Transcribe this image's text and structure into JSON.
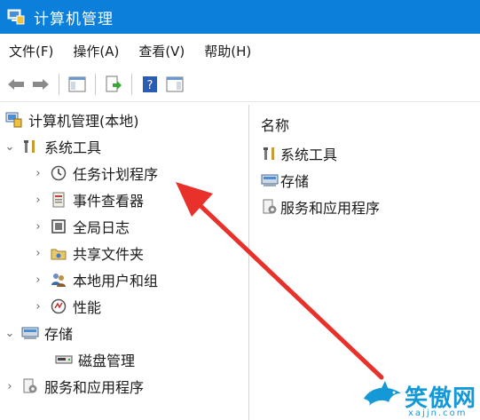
{
  "window": {
    "title": "计算机管理"
  },
  "menu": [
    "文件(F)",
    "操作(A)",
    "查看(V)",
    "帮助(H)"
  ],
  "toolbar_icons": [
    "back-arrow-icon",
    "forward-arrow-icon",
    "console-tree-icon",
    "export-list-icon",
    "help-icon",
    "action-pane-icon"
  ],
  "tree": {
    "root": "计算机管理(本地)",
    "system_tools": "系统工具",
    "task_scheduler": "任务计划程序",
    "event_viewer": "事件查看器",
    "global_logs": "全局日志",
    "shared_folders": "共享文件夹",
    "local_users": "本地用户和组",
    "performance": "性能",
    "storage": "存储",
    "disk_management": "磁盘管理",
    "services_apps": "服务和应用程序"
  },
  "right": {
    "column_header": "名称",
    "items": [
      "系统工具",
      "存储",
      "服务和应用程序"
    ]
  },
  "watermark": {
    "text": "笑傲网",
    "sub": "xajjn.com"
  },
  "colors": {
    "titlebar": "#0b7fd9",
    "arrow": "#e8312a",
    "watermark": "#1598d8"
  }
}
